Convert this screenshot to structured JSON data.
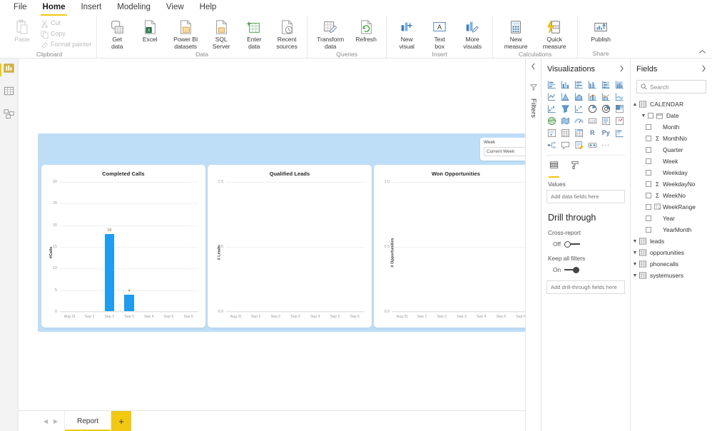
{
  "ribbon": {
    "tabs": [
      {
        "label": "File",
        "active": false
      },
      {
        "label": "Home",
        "active": true
      },
      {
        "label": "Insert",
        "active": false
      },
      {
        "label": "Modeling",
        "active": false
      },
      {
        "label": "View",
        "active": false
      },
      {
        "label": "Help",
        "active": false
      }
    ],
    "groups": [
      {
        "name": "Clipboard",
        "buttons": [
          {
            "label": "Paste",
            "icon": "paste-icon",
            "disabled": true
          },
          {
            "label": "Cut",
            "icon": "cut-icon",
            "disabled": true
          },
          {
            "label": "Copy",
            "icon": "copy-icon",
            "disabled": true
          },
          {
            "label": "Format painter",
            "icon": "format-painter-icon",
            "disabled": true
          }
        ]
      },
      {
        "name": "Data",
        "buttons": [
          {
            "label": "Get\ndata",
            "icon": "get-data-icon"
          },
          {
            "label": "Excel",
            "icon": "excel-icon"
          },
          {
            "label": "Power BI\ndatasets",
            "icon": "powerbi-datasets-icon"
          },
          {
            "label": "SQL\nServer",
            "icon": "sql-server-icon"
          },
          {
            "label": "Enter\ndata",
            "icon": "enter-data-icon"
          },
          {
            "label": "Recent\nsources",
            "icon": "recent-sources-icon"
          }
        ]
      },
      {
        "name": "Queries",
        "buttons": [
          {
            "label": "Transform\ndata",
            "icon": "transform-data-icon"
          },
          {
            "label": "Refresh",
            "icon": "refresh-icon"
          }
        ]
      },
      {
        "name": "Insert",
        "buttons": [
          {
            "label": "New\nvisual",
            "icon": "new-visual-icon"
          },
          {
            "label": "Text\nbox",
            "icon": "text-box-icon"
          },
          {
            "label": "More\nvisuals",
            "icon": "more-visuals-icon"
          }
        ]
      },
      {
        "name": "Calculations",
        "buttons": [
          {
            "label": "New\nmeasure",
            "icon": "new-measure-icon"
          },
          {
            "label": "Quick\nmeasure",
            "icon": "quick-measure-icon"
          }
        ]
      },
      {
        "name": "Share",
        "buttons": [
          {
            "label": "Publish",
            "icon": "publish-icon"
          }
        ]
      }
    ],
    "collapse_icon": "chevron-up-icon"
  },
  "view_rail": [
    {
      "name": "report-view",
      "icon": "report-view-icon",
      "active": true
    },
    {
      "name": "data-view",
      "icon": "data-view-icon",
      "active": false
    },
    {
      "name": "model-view",
      "icon": "model-view-icon",
      "active": false
    }
  ],
  "canvas": {
    "slicer": {
      "label": "Week",
      "value": "Current Week",
      "chevron": "chevron-down-icon"
    },
    "page_background": "#bedef8"
  },
  "chart_data": [
    {
      "type": "bar",
      "title": "Completed Calls",
      "xlabel": "",
      "ylabel": "#Calls",
      "categories": [
        "Aug 31",
        "Sep 1",
        "Sep 2",
        "Sep 3",
        "Sep 4",
        "Sep 5",
        "Sep 6"
      ],
      "values": [
        0,
        0,
        18,
        4,
        0,
        0,
        0
      ],
      "data_labels": [
        "",
        "",
        "18",
        "4",
        "",
        "",
        ""
      ],
      "yticks": [
        0,
        5,
        10,
        15,
        20,
        25,
        30
      ],
      "ytick_labels": [
        "0",
        "5",
        "10",
        "15",
        "20",
        "25",
        "30"
      ],
      "ylim": [
        0,
        30
      ],
      "bar_color": "#1f9bf0",
      "grid": true,
      "legend": "none"
    },
    {
      "type": "bar",
      "title": "Qualified Leads",
      "xlabel": "",
      "ylabel": "# Leads",
      "categories": [
        "Aug 31",
        "Sep 1",
        "Sep 2",
        "Sep 3",
        "Sep 4",
        "Sep 5",
        "Sep 6"
      ],
      "values": [
        0,
        0,
        0,
        0,
        0,
        0,
        0
      ],
      "data_labels": [
        "",
        "",
        "",
        "",
        "",
        "",
        ""
      ],
      "yticks": [
        0,
        0.5,
        1
      ],
      "ytick_labels": [
        "0.0",
        "0.5",
        "1.0"
      ],
      "ylim": [
        0,
        1
      ],
      "bar_color": "#1f9bf0",
      "grid": true,
      "legend": "none"
    },
    {
      "type": "bar",
      "title": "Won Opportunities",
      "xlabel": "",
      "ylabel": "# Opportunities",
      "categories": [
        "Aug 31",
        "Sep 1",
        "Sep 2",
        "Sep 3",
        "Sep 4",
        "Sep 5",
        "Sep 6"
      ],
      "values": [
        0,
        0,
        0,
        0,
        0,
        0,
        0
      ],
      "data_labels": [
        "",
        "",
        "",
        "",
        "",
        "",
        ""
      ],
      "yticks": [
        0,
        0.5,
        1
      ],
      "ytick_labels": [
        "0.0",
        "0.5",
        "1.0"
      ],
      "ylim": [
        0,
        1
      ],
      "bar_color": "#1f9bf0",
      "grid": true,
      "legend": "none"
    }
  ],
  "page_bar": {
    "prev_icon": "chevron-left-icon",
    "next_icon": "chevron-right-icon",
    "tabs": [
      {
        "label": "Report",
        "active": true
      }
    ],
    "add_label": "+"
  },
  "filters_pane": {
    "collapse_icon": "chevron-left-icon",
    "icon": "filter-icon",
    "title": "Filters"
  },
  "visualizations": {
    "title": "Visualizations",
    "expand_icon": "chevron-right-icon",
    "icons": [
      "stacked-bar-chart-icon",
      "stacked-column-chart-icon",
      "clustered-bar-chart-icon",
      "clustered-column-chart-icon",
      "100-stacked-bar-chart-icon",
      "100-stacked-column-chart-icon",
      "line-chart-icon",
      "area-chart-icon",
      "stacked-area-chart-icon",
      "line-stacked-column-icon",
      "line-clustered-column-icon",
      "ribbon-chart-icon",
      "waterfall-chart-icon",
      "funnel-chart-icon",
      "scatter-chart-icon",
      "pie-chart-icon",
      "donut-chart-icon",
      "treemap-icon",
      "map-icon",
      "filled-map-icon",
      "gauge-icon",
      "card-icon",
      "multi-row-card-icon",
      "kpi-icon",
      "slicer-icon",
      "table-icon",
      "matrix-icon",
      "r-script-visual-icon",
      "python-visual-icon",
      "key-influencers-icon",
      "decomposition-tree-icon",
      "qna-icon",
      "smart-narrative-icon",
      "paginated-report-icon",
      "more-options-icon"
    ],
    "icon_text": {
      "r-script-visual-icon": "R",
      "python-visual-icon": "Py",
      "more-options-icon": "···"
    },
    "field_tabs": [
      {
        "name": "fields-tab",
        "icon": "fields-stack-icon",
        "active": true
      },
      {
        "name": "format-tab",
        "icon": "paint-roller-icon",
        "active": false
      }
    ],
    "values_label": "Values",
    "values_placeholder": "Add data fields here",
    "drill_through": {
      "title": "Drill through",
      "cross_report_label": "Cross-report",
      "cross_report_state": "Off",
      "cross_report_on": false,
      "keep_filters_label": "Keep all filters",
      "keep_filters_state": "On",
      "keep_filters_on": true,
      "placeholder": "Add drill-through fields here"
    }
  },
  "fields": {
    "title": "Fields",
    "expand_icon": "chevron-right-icon",
    "search_icon": "search-icon",
    "search_placeholder": "Search",
    "tree": [
      {
        "label": "CALENDAR",
        "type": "table",
        "expanded": true,
        "indent": 0,
        "chevron": "chevron-up-icon",
        "checkbox": false,
        "sigma": false,
        "icon": "table-icon"
      },
      {
        "label": "Date",
        "type": "hierarchy",
        "expanded": true,
        "indent": 1,
        "chevron": "chevron-down-icon",
        "checkbox": true,
        "sigma": false,
        "icon": "date-hierarchy-icon"
      },
      {
        "label": "Month",
        "type": "field",
        "indent": 2,
        "checkbox": true,
        "sigma": false
      },
      {
        "label": "MonthNo",
        "type": "field",
        "indent": 2,
        "checkbox": true,
        "sigma": true
      },
      {
        "label": "Quarter",
        "type": "field",
        "indent": 2,
        "checkbox": true,
        "sigma": false
      },
      {
        "label": "Week",
        "type": "field",
        "indent": 2,
        "checkbox": true,
        "sigma": false
      },
      {
        "label": "Weekday",
        "type": "field",
        "indent": 2,
        "checkbox": true,
        "sigma": false
      },
      {
        "label": "WeekdayNo",
        "type": "field",
        "indent": 2,
        "checkbox": true,
        "sigma": true
      },
      {
        "label": "WeekNo",
        "type": "field",
        "indent": 2,
        "checkbox": true,
        "sigma": true
      },
      {
        "label": "WeekRange",
        "type": "field",
        "indent": 2,
        "checkbox": true,
        "sigma": false,
        "icon": "calculated-column-icon"
      },
      {
        "label": "Year",
        "type": "field",
        "indent": 2,
        "checkbox": true,
        "sigma": false
      },
      {
        "label": "YearMonth",
        "type": "field",
        "indent": 2,
        "checkbox": true,
        "sigma": false
      },
      {
        "label": "leads",
        "type": "table",
        "expanded": false,
        "indent": 0,
        "chevron": "chevron-down-icon",
        "checkbox": false,
        "sigma": false,
        "icon": "table-icon"
      },
      {
        "label": "opportunities",
        "type": "table",
        "expanded": false,
        "indent": 0,
        "chevron": "chevron-down-icon",
        "checkbox": false,
        "sigma": false,
        "icon": "table-icon"
      },
      {
        "label": "phonecalls",
        "type": "table",
        "expanded": false,
        "indent": 0,
        "chevron": "chevron-down-icon",
        "checkbox": false,
        "sigma": false,
        "icon": "table-icon"
      },
      {
        "label": "systemusers",
        "type": "table",
        "expanded": false,
        "indent": 0,
        "chevron": "chevron-down-icon",
        "checkbox": false,
        "sigma": false,
        "icon": "table-icon"
      }
    ]
  }
}
